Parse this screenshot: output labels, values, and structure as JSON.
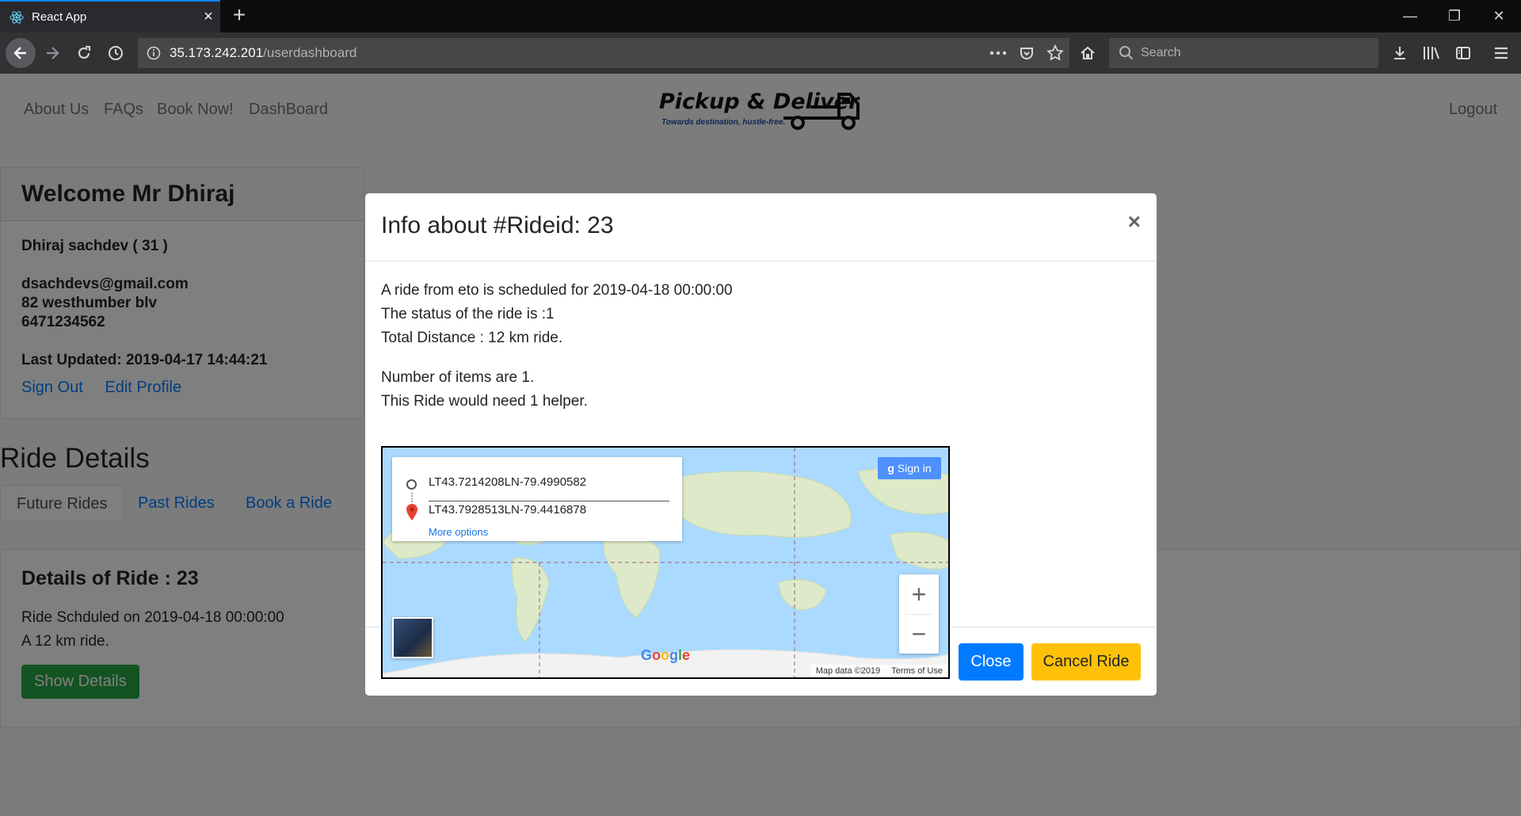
{
  "browser": {
    "tab_title": "React App",
    "url_host": "35.173.242.201",
    "url_path": "/userdashboard",
    "search_placeholder": "Search"
  },
  "site": {
    "nav": [
      "About Us",
      "FAQs",
      "Book Now!",
      "DashBoard"
    ],
    "logout": "Logout",
    "logo_text": "Pickup & Deliver",
    "logo_tagline": "Towards destination, hustle-free."
  },
  "welcome": {
    "title": "Welcome Mr Dhiraj",
    "name_age": "Dhiraj sachdev ( 31 )",
    "email": "dsachdevs@gmail.com",
    "address": "82 westhumber blv",
    "phone": "6471234562",
    "last_updated": "Last Updated: 2019-04-17 14:44:21",
    "sign_out": "Sign Out",
    "edit_profile": "Edit Profile"
  },
  "rides": {
    "heading": "Ride Details",
    "tabs": [
      "Future Rides",
      "Past Rides",
      "Book a Ride"
    ],
    "active_tab": "Future Rides",
    "card_title": "Details of Ride : 23",
    "scheduled": "Ride Schduled on 2019-04-18 00:00:00",
    "distance": "A 12 km ride.",
    "show_details": "Show Details"
  },
  "modal": {
    "title": "Info about #Rideid: 23",
    "close_x": "×",
    "line1": "A ride from eto is scheduled for 2019-04-18 00:00:00",
    "line2": "The status of the ride is :1",
    "line3": "Total Distance : 12 km ride.",
    "line4": "Number of items are 1.",
    "line5": "This Ride would need 1 helper.",
    "close_btn": "Close",
    "cancel_btn": "Cancel Ride"
  },
  "map": {
    "origin": "LT43.7214208LN-79.4990582",
    "destination": "LT43.7928513LN-79.4416878",
    "more_options": "More options",
    "sign_in": "Sign in",
    "zoom_in": "+",
    "zoom_out": "−",
    "google_letters": [
      "G",
      "o",
      "o",
      "g",
      "l",
      "e"
    ],
    "google_colors": [
      "#4285f4",
      "#ea4335",
      "#fbbc05",
      "#4285f4",
      "#34a853",
      "#ea4335"
    ],
    "map_data": "Map data ©2019",
    "terms": "Terms of Use"
  },
  "colors": {
    "primary": "#007bff",
    "success": "#28a745",
    "warning": "#ffc107",
    "tab_accent": "#0a84ff"
  }
}
